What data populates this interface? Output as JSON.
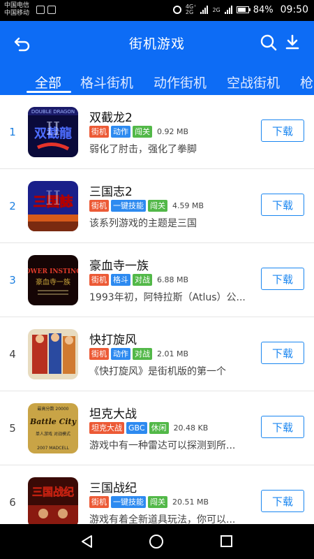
{
  "status": {
    "carrier1": "中国电信",
    "carrier2": "中国移动",
    "net_top": "4G⁺",
    "net_bottom": "2G",
    "net2": "2G",
    "battery_text": "84%",
    "battery_level": 0.84,
    "time": "09:50"
  },
  "header": {
    "title": "街机游戏",
    "tabs": [
      {
        "label": "全部"
      },
      {
        "label": "格斗街机"
      },
      {
        "label": "动作街机"
      },
      {
        "label": "空战街机"
      },
      {
        "label": "枪"
      }
    ]
  },
  "colors": {
    "primary": "#0d6cf5",
    "tag_red": "#ec5a36",
    "tag_blue": "#2d8af0",
    "tag_green": "#52b848",
    "rank_blue": "#1c7fe0"
  },
  "games": [
    {
      "rank": "1",
      "name": "双截龙2",
      "tags": [
        {
          "text": "街机",
          "color": "#ec5a36"
        },
        {
          "text": "动作",
          "color": "#2d8af0"
        },
        {
          "text": "闯关",
          "color": "#52b848"
        }
      ],
      "size": "0.92 MB",
      "desc": "弱化了肘击，强化了拳脚",
      "download": "下载"
    },
    {
      "rank": "2",
      "name": "三国志2",
      "tags": [
        {
          "text": "街机",
          "color": "#ec5a36"
        },
        {
          "text": "一键技能",
          "color": "#2d8af0"
        },
        {
          "text": "闯关",
          "color": "#52b848"
        }
      ],
      "size": "4.59 MB",
      "desc": "该系列游戏的主题是三国",
      "download": "下载"
    },
    {
      "rank": "3",
      "name": "豪血寺一族",
      "tags": [
        {
          "text": "街机",
          "color": "#ec5a36"
        },
        {
          "text": "格斗",
          "color": "#2d8af0"
        },
        {
          "text": "对战",
          "color": "#52b848"
        }
      ],
      "size": "6.88 MB",
      "desc": "1993年初，阿特拉斯（Atlus）公...",
      "download": "下载"
    },
    {
      "rank": "4",
      "name": "快打旋风",
      "tags": [
        {
          "text": "街机",
          "color": "#ec5a36"
        },
        {
          "text": "动作",
          "color": "#2d8af0"
        },
        {
          "text": "对战",
          "color": "#52b848"
        }
      ],
      "size": "2.01 MB",
      "desc": "《快打旋风》是街机版的第一个",
      "download": "下载"
    },
    {
      "rank": "5",
      "name": "坦克大战",
      "tags": [
        {
          "text": "坦克大战",
          "color": "#ec5a36"
        },
        {
          "text": "GBC",
          "color": "#2d8af0"
        },
        {
          "text": "休闲",
          "color": "#52b848"
        }
      ],
      "size": "20.48 KB",
      "desc": " 游戏中有一种雷达可以探测到所...",
      "download": "下载"
    },
    {
      "rank": "6",
      "name": "三国战纪",
      "tags": [
        {
          "text": "街机",
          "color": "#ec5a36"
        },
        {
          "text": "一键技能",
          "color": "#2d8af0"
        },
        {
          "text": "闯关",
          "color": "#52b848"
        }
      ],
      "size": "20.51 MB",
      "desc": " 游戏有着全新道具玩法，你可以...",
      "download": "下载"
    }
  ],
  "thumbs": [
    {
      "line1": "DOUBLE DRAGON",
      "big": "双截龍",
      "sub": "II"
    },
    {
      "line1": "",
      "big": "三国誌",
      "sub": "II"
    },
    {
      "line1": "POWER INSTINCT",
      "big": "豪血寺一族",
      "sub": ""
    },
    {
      "line1": "",
      "big": "",
      "sub": ""
    },
    {
      "line1": "最高分数 20000",
      "big": "Battle City",
      "sub": "单人游戏 对战模式",
      "footer": "2007 MADCELL"
    },
    {
      "line1": "",
      "big": "三国战纪",
      "sub": ""
    }
  ]
}
